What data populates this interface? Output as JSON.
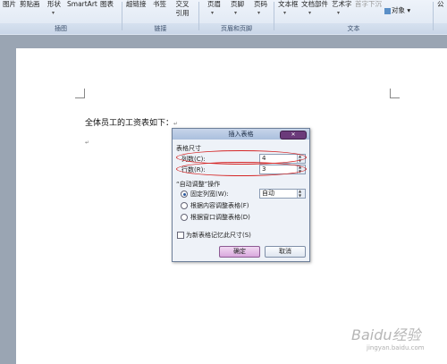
{
  "ribbon": {
    "items": {
      "picture": "图片",
      "clipart": "剪贴画",
      "shapes": "形状",
      "smartart": "SmartArt",
      "chart": "图表",
      "hyperlink": "超链接",
      "bookmark": "书签",
      "crossref_line1": "交叉",
      "crossref_line2": "引用",
      "header": "页眉",
      "footer": "页脚",
      "page_number": "页码",
      "textbox": "文本框",
      "quickparts": "文档部件",
      "wordart": "艺术字",
      "dropcap": "首字下沉",
      "object": "对象",
      "more": "公"
    },
    "groups": {
      "illustrations": "插图",
      "links": "链接",
      "header_footer": "页眉和页脚",
      "text": "文本"
    }
  },
  "document": {
    "body_text": "全体员工的工资表如下：",
    "para_mark": "↵"
  },
  "dialog": {
    "title": "插入表格",
    "close": "✕",
    "table_size_label": "表格尺寸",
    "columns_label": "列数(C):",
    "columns_value": "4",
    "rows_label": "行数(R):",
    "rows_value": "3",
    "autofit_label": "“自动调整”操作",
    "fixed_width_label": "固定列宽(W):",
    "fixed_width_value": "自动",
    "autofit_contents_label": "根据内容调整表格(F)",
    "autofit_window_label": "根据窗口调整表格(D)",
    "remember_label": "为新表格记忆此尺寸(S)",
    "ok_label": "确定",
    "cancel_label": "取消",
    "selected_option": "fixed_width"
  },
  "watermark": {
    "brand": "Baidu经验",
    "url": "jingyan.baidu.com"
  },
  "colors": {
    "highlight": "#d52525",
    "ok_button": "#d9a8dd",
    "close_button": "#6b3a7a"
  }
}
